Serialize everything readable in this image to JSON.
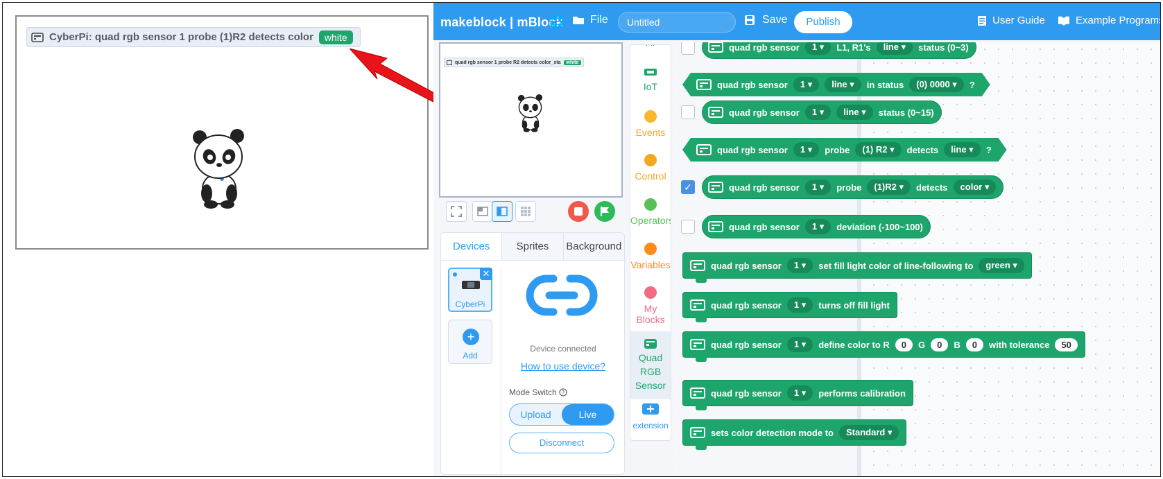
{
  "zoom": {
    "monitor_label": "CyberPi: quad rgb sensor 1 probe (1)R2 detects color",
    "monitor_value": "white"
  },
  "topbar": {
    "brand": "makeblock | mBlock",
    "file_label": "File",
    "project_title": "Untitled",
    "save_label": "Save",
    "publish_label": "Publish",
    "user_guide_label": "User Guide",
    "example_programs_label": "Example Programs"
  },
  "stage": {
    "monitor_label": "quad rgb sensor 1 probe R2 detects color_sta",
    "monitor_value": "white"
  },
  "devices_panel": {
    "tabs": [
      "Devices",
      "Sprites",
      "Background"
    ],
    "device_name": "CyberPi",
    "add_label": "Add",
    "connected_text": "Device connected",
    "how_to_link": "How to use device?",
    "mode_switch_label": "Mode Switch",
    "mode_upload": "Upload",
    "mode_live": "Live",
    "disconnect_label": "Disconnect"
  },
  "categories": {
    "top_partial": "AI",
    "iot": "IoT",
    "events": "Events",
    "control": "Control",
    "operators": "Operators",
    "variables": "Variables",
    "my_blocks": "My Blocks",
    "quad_line1": "Quad",
    "quad_line2": "RGB",
    "quad_line3": "Sensor",
    "extension": "extension",
    "colors": {
      "iot": "#1da56b",
      "events": "#f5b82e",
      "control": "#f5a623",
      "operators": "#59c059",
      "variables": "#ff8c1a",
      "my_blocks": "#f06b85",
      "quad": "#1da56b"
    }
  },
  "blocks": {
    "b0": {
      "text1": "quad rgb sensor",
      "port": "1",
      "text2": "L1, R1's",
      "opt": "line",
      "text3": "status (0~3)"
    },
    "b1": {
      "text1": "quad rgb sensor",
      "port": "1",
      "opt": "line",
      "text2": "in status",
      "opt2": "(0) 0000",
      "text3": "?"
    },
    "b2": {
      "text1": "quad rgb sensor",
      "port": "1",
      "opt": "line",
      "text2": "status (0~15)"
    },
    "b3": {
      "text1": "quad rgb sensor",
      "port": "1",
      "text2": "probe",
      "probe": "(1) R2",
      "text3": "detects",
      "opt": "line",
      "text4": "?"
    },
    "b4": {
      "text1": "quad rgb sensor",
      "port": "1",
      "text2": "probe",
      "probe": "(1)R2",
      "text3": "detects",
      "opt": "color"
    },
    "b5": {
      "text1": "quad rgb sensor",
      "port": "1",
      "text2": "deviation (-100~100)"
    },
    "b6": {
      "text1": "quad rgb sensor",
      "port": "1",
      "text2": "set fill light color of line-following to",
      "opt": "green"
    },
    "b7": {
      "text1": "quad rgb sensor",
      "port": "1",
      "text2": "turns off fill light"
    },
    "b8": {
      "text1": "quad rgb sensor",
      "port": "1",
      "text2": "define color to R",
      "r": "0",
      "g_label": "G",
      "g": "0",
      "b_label": "B",
      "b": "0",
      "text3": "with tolerance",
      "tol": "50"
    },
    "b9": {
      "text1": "quad rgb sensor",
      "port": "1",
      "text2": "performs calibration"
    },
    "b10": {
      "text1": "sets color detection mode to",
      "opt": "Standard"
    }
  }
}
